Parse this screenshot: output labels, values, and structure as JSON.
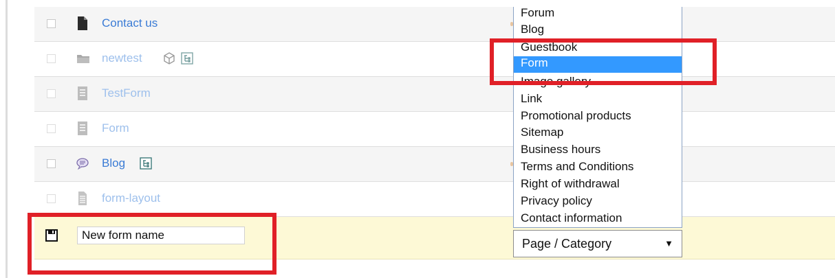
{
  "rows": [
    {
      "label": "Contact us",
      "icon": "page-icon"
    },
    {
      "label": "newtest",
      "icon": "folder-icon",
      "extras": [
        "cube-icon",
        "sitemap-icon"
      ]
    },
    {
      "label": "TestForm",
      "icon": "form-icon"
    },
    {
      "label": "Form",
      "icon": "form-icon"
    },
    {
      "label": "Blog",
      "icon": "blog-icon",
      "extras": [
        "sitemap-icon"
      ]
    },
    {
      "label": "form-layout",
      "icon": "document-icon"
    }
  ],
  "new_row": {
    "name_value": "New form name",
    "save_icon": "save-icon"
  },
  "type_select": {
    "value": "Page / Category",
    "options": [
      "Forum",
      "Blog",
      "Guestbook",
      "Form",
      "Image gallery",
      "Link",
      "Promotional products",
      "Sitemap",
      "Business hours",
      "Terms and Conditions",
      "Right of withdrawal",
      "Privacy policy",
      "Contact information"
    ],
    "highlighted": "Form"
  },
  "colors": {
    "selection": "#3399ff",
    "highlight_box": "#e02027",
    "link": "#3a7bd5"
  }
}
